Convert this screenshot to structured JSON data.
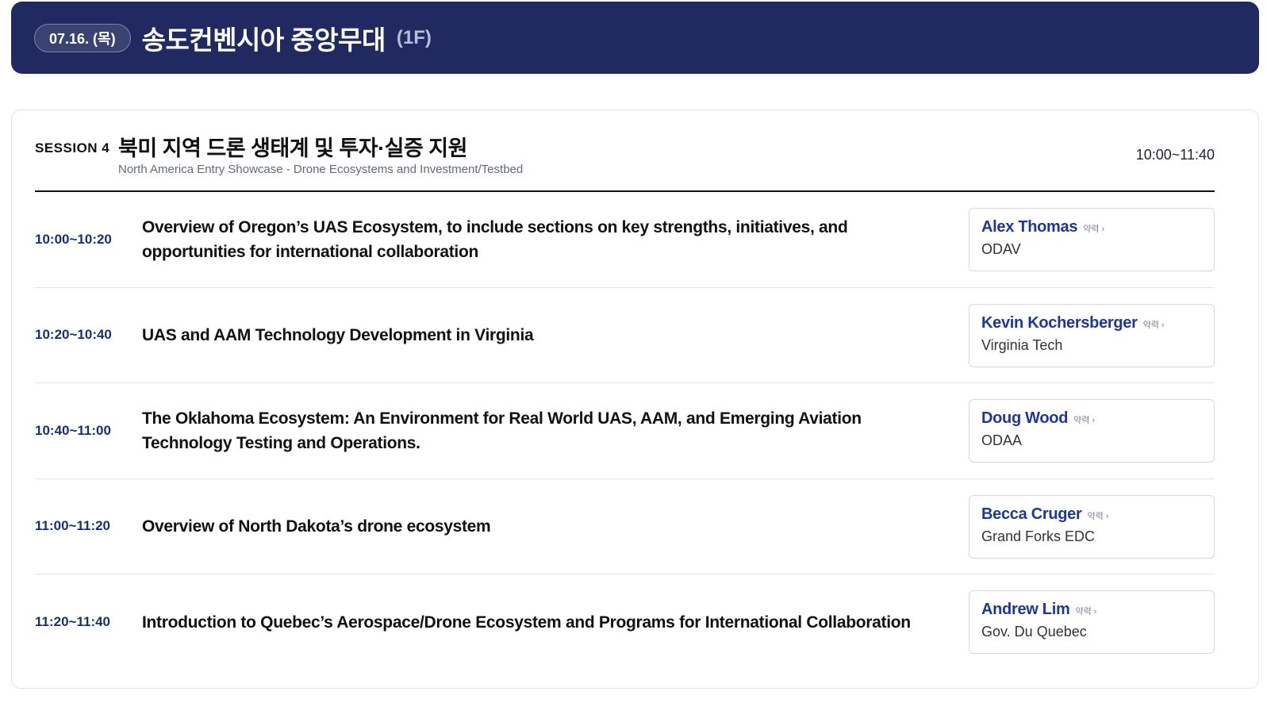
{
  "banner": {
    "date": "07.16. (목)",
    "venue": "송도컨벤시아 중앙무대",
    "floor": "(1F)",
    "background_color": "#202a60"
  },
  "session": {
    "label": "SESSION 4",
    "title": "북미 지역 드론 생태계 및 투자·실증 지원",
    "subtitle": "North America Entry Showcase - Drone Ecosystems and Investment/Testbed",
    "time": "10:00~11:40"
  },
  "talks": [
    {
      "time": "10:00~10:20",
      "title": "Overview of Oregon’s UAS Ecosystem, to include sections on key strengths, initiatives, and opportunities for international collaboration",
      "speaker": "Alex Thomas",
      "bio_label": "약력 ›",
      "org": "ODAV"
    },
    {
      "time": "10:20~10:40",
      "title": "UAS and AAM Technology Development in Virginia",
      "speaker": "Kevin Kochersberger",
      "bio_label": "약력 ›",
      "org": "Virginia Tech"
    },
    {
      "time": "10:40~11:00",
      "title": "The Oklahoma Ecosystem: An Environment for Real World UAS, AAM, and Emerging Aviation Technology Testing and Operations.",
      "speaker": "Doug Wood",
      "bio_label": "약력 ›",
      "org": "ODAA"
    },
    {
      "time": "11:00~11:20",
      "title": "Overview of North Dakota’s drone ecosystem",
      "speaker": "Becca Cruger",
      "bio_label": "약력 ›",
      "org": "Grand Forks EDC"
    },
    {
      "time": "11:20~11:40",
      "title": "Introduction to Quebec’s Aerospace/Drone Ecosystem and Programs for International Collaboration",
      "speaker": "Andrew Lim",
      "bio_label": "약력 ›",
      "org": "Gov. Du Quebec"
    }
  ]
}
